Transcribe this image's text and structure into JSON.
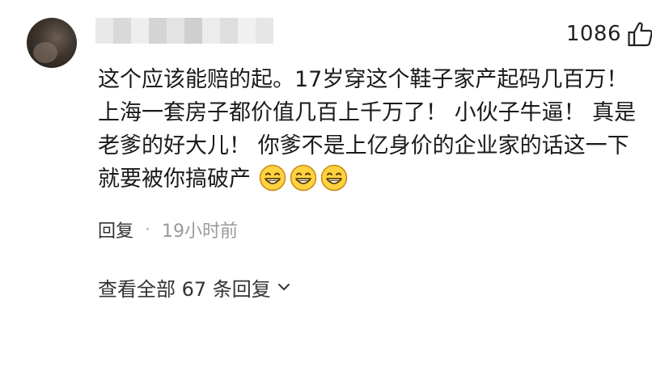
{
  "comment": {
    "like_count": "1086",
    "lines": [
      "这个应该能赔的起。17岁穿这个鞋子家产起码几百万！",
      "上海一套房子都价值几百上千万了！ 小伙子牛逼！ 真是",
      "老爹的好大儿！ 你爹不是上亿身价的企业家的话这一下",
      "就要被你搞破产"
    ],
    "emojis": [
      "grin-emoji",
      "grin-emoji",
      "grin-emoji"
    ],
    "reply_label": "回复",
    "separator": "·",
    "time": "19小时前",
    "view_replies_label": "查看全部 67 条回复"
  },
  "colors": {
    "text": "#1a1a1a",
    "meta": "#9a9a9a",
    "emoji_face": "#ffd23f",
    "emoji_outline": "#c98a12"
  },
  "icons": {
    "like": "thumbs-up-icon",
    "expand": "chevron-down-icon"
  }
}
